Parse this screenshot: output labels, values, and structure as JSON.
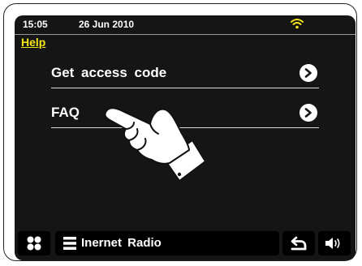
{
  "status_bar": {
    "time": "15:05",
    "date": "26 Jun 2010",
    "wifi_icon": "wifi-icon",
    "wifi_color": "#f2e418"
  },
  "header": {
    "title": "Help",
    "title_color": "#f2e418"
  },
  "menu": {
    "items": [
      {
        "label": "Get access code",
        "icon": "chevron-right-icon"
      },
      {
        "label": "FAQ",
        "icon": "chevron-right-icon"
      }
    ]
  },
  "overlay": {
    "icon": "pointing-hand-icon"
  },
  "bottom_bar": {
    "home_icon": "home-grid-icon",
    "source_icon": "menu-list-icon",
    "source_label": "Inernet Radio",
    "back_icon": "back-arrow-icon",
    "volume_icon": "volume-icon"
  },
  "colors": {
    "screen_background": "#151515",
    "accent": "#f2e418",
    "text": "#ffffff"
  }
}
